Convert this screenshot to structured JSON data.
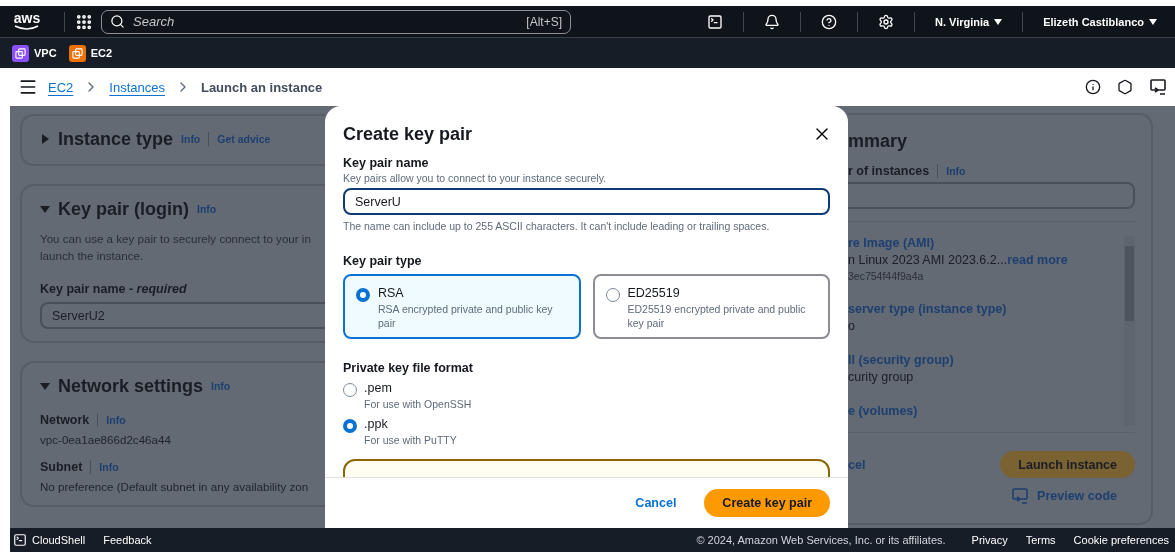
{
  "top_nav": {
    "logo": "aws",
    "search_placeholder": "Search",
    "shortcut": "[Alt+S]",
    "region": "N. Virginia",
    "user": "Elizeth Castiblanco"
  },
  "favorites": [
    {
      "label": "VPC",
      "color": "#8c4fff"
    },
    {
      "label": "EC2",
      "color": "#ed7100"
    }
  ],
  "breadcrumbs": [
    {
      "label": "EC2",
      "link": true
    },
    {
      "label": "Instances",
      "link": true
    },
    {
      "label": "Launch an instance",
      "link": false
    }
  ],
  "sections": [
    {
      "title": "Instance type",
      "expanded": false,
      "info": "Info",
      "extra_link": "Get advice"
    },
    {
      "title": "Key pair (login)",
      "expanded": true,
      "info": "Info",
      "description": [
        "You can use a key pair to securely connect to your in",
        "launch the instance."
      ],
      "field_label": "Key pair name - *required*",
      "field_value": "ServerU2"
    },
    {
      "title": "Network settings",
      "expanded": true,
      "info": "Info",
      "fields": [
        {
          "label": "Network",
          "info": "Info",
          "value": "vpc-0ea1ae866d2c46a44"
        },
        {
          "label": "Subnet",
          "info": "Info",
          "value": "No preference (Default subnet in any availability zon"
        }
      ]
    }
  ],
  "modal": {
    "title": "Create key pair",
    "name_field": {
      "label": "Key pair name",
      "description": "Key pairs allow you to connect to your instance securely.",
      "value": "ServerU",
      "hint": "The name can include up to 255 ASCII characters. It can't include leading or trailing spaces."
    },
    "key_type": {
      "label": "Key pair type",
      "options": [
        {
          "label": "RSA",
          "description": "RSA encrypted private and public key pair",
          "selected": true
        },
        {
          "label": "ED25519",
          "description": "ED25519 encrypted private and public key pair",
          "selected": false
        }
      ]
    },
    "file_format": {
      "label": "Private key file format",
      "options": [
        {
          "label": ".pem",
          "description": "For use with OpenSSH",
          "selected": false
        },
        {
          "label": ".ppk",
          "description": "For use with PuTTY",
          "selected": true
        }
      ]
    },
    "cancel": "Cancel",
    "create": "Create key pair"
  },
  "summary": {
    "title": "mmary",
    "instances_label": "r of instances",
    "info": "Info",
    "items": [
      {
        "heading": "re Image (AMI)",
        "value": "n Linux 2023 AMI 2023.6.2...",
        "link": "read more",
        "sub": "3ec754f44f9a4a"
      },
      {
        "heading": "server type (instance type)",
        "value": "o"
      },
      {
        "heading": "ll (security group)",
        "value": "curity group"
      },
      {
        "heading": "e (volumes)"
      }
    ],
    "cancel": "cel",
    "launch": "Launch instance",
    "preview": "Preview code"
  },
  "footer": {
    "cloudshell": "CloudShell",
    "feedback": "Feedback",
    "copyright": "© 2024, Amazon Web Services, Inc. or its affiliates.",
    "links": [
      "Privacy",
      "Terms",
      "Cookie preferences"
    ]
  }
}
